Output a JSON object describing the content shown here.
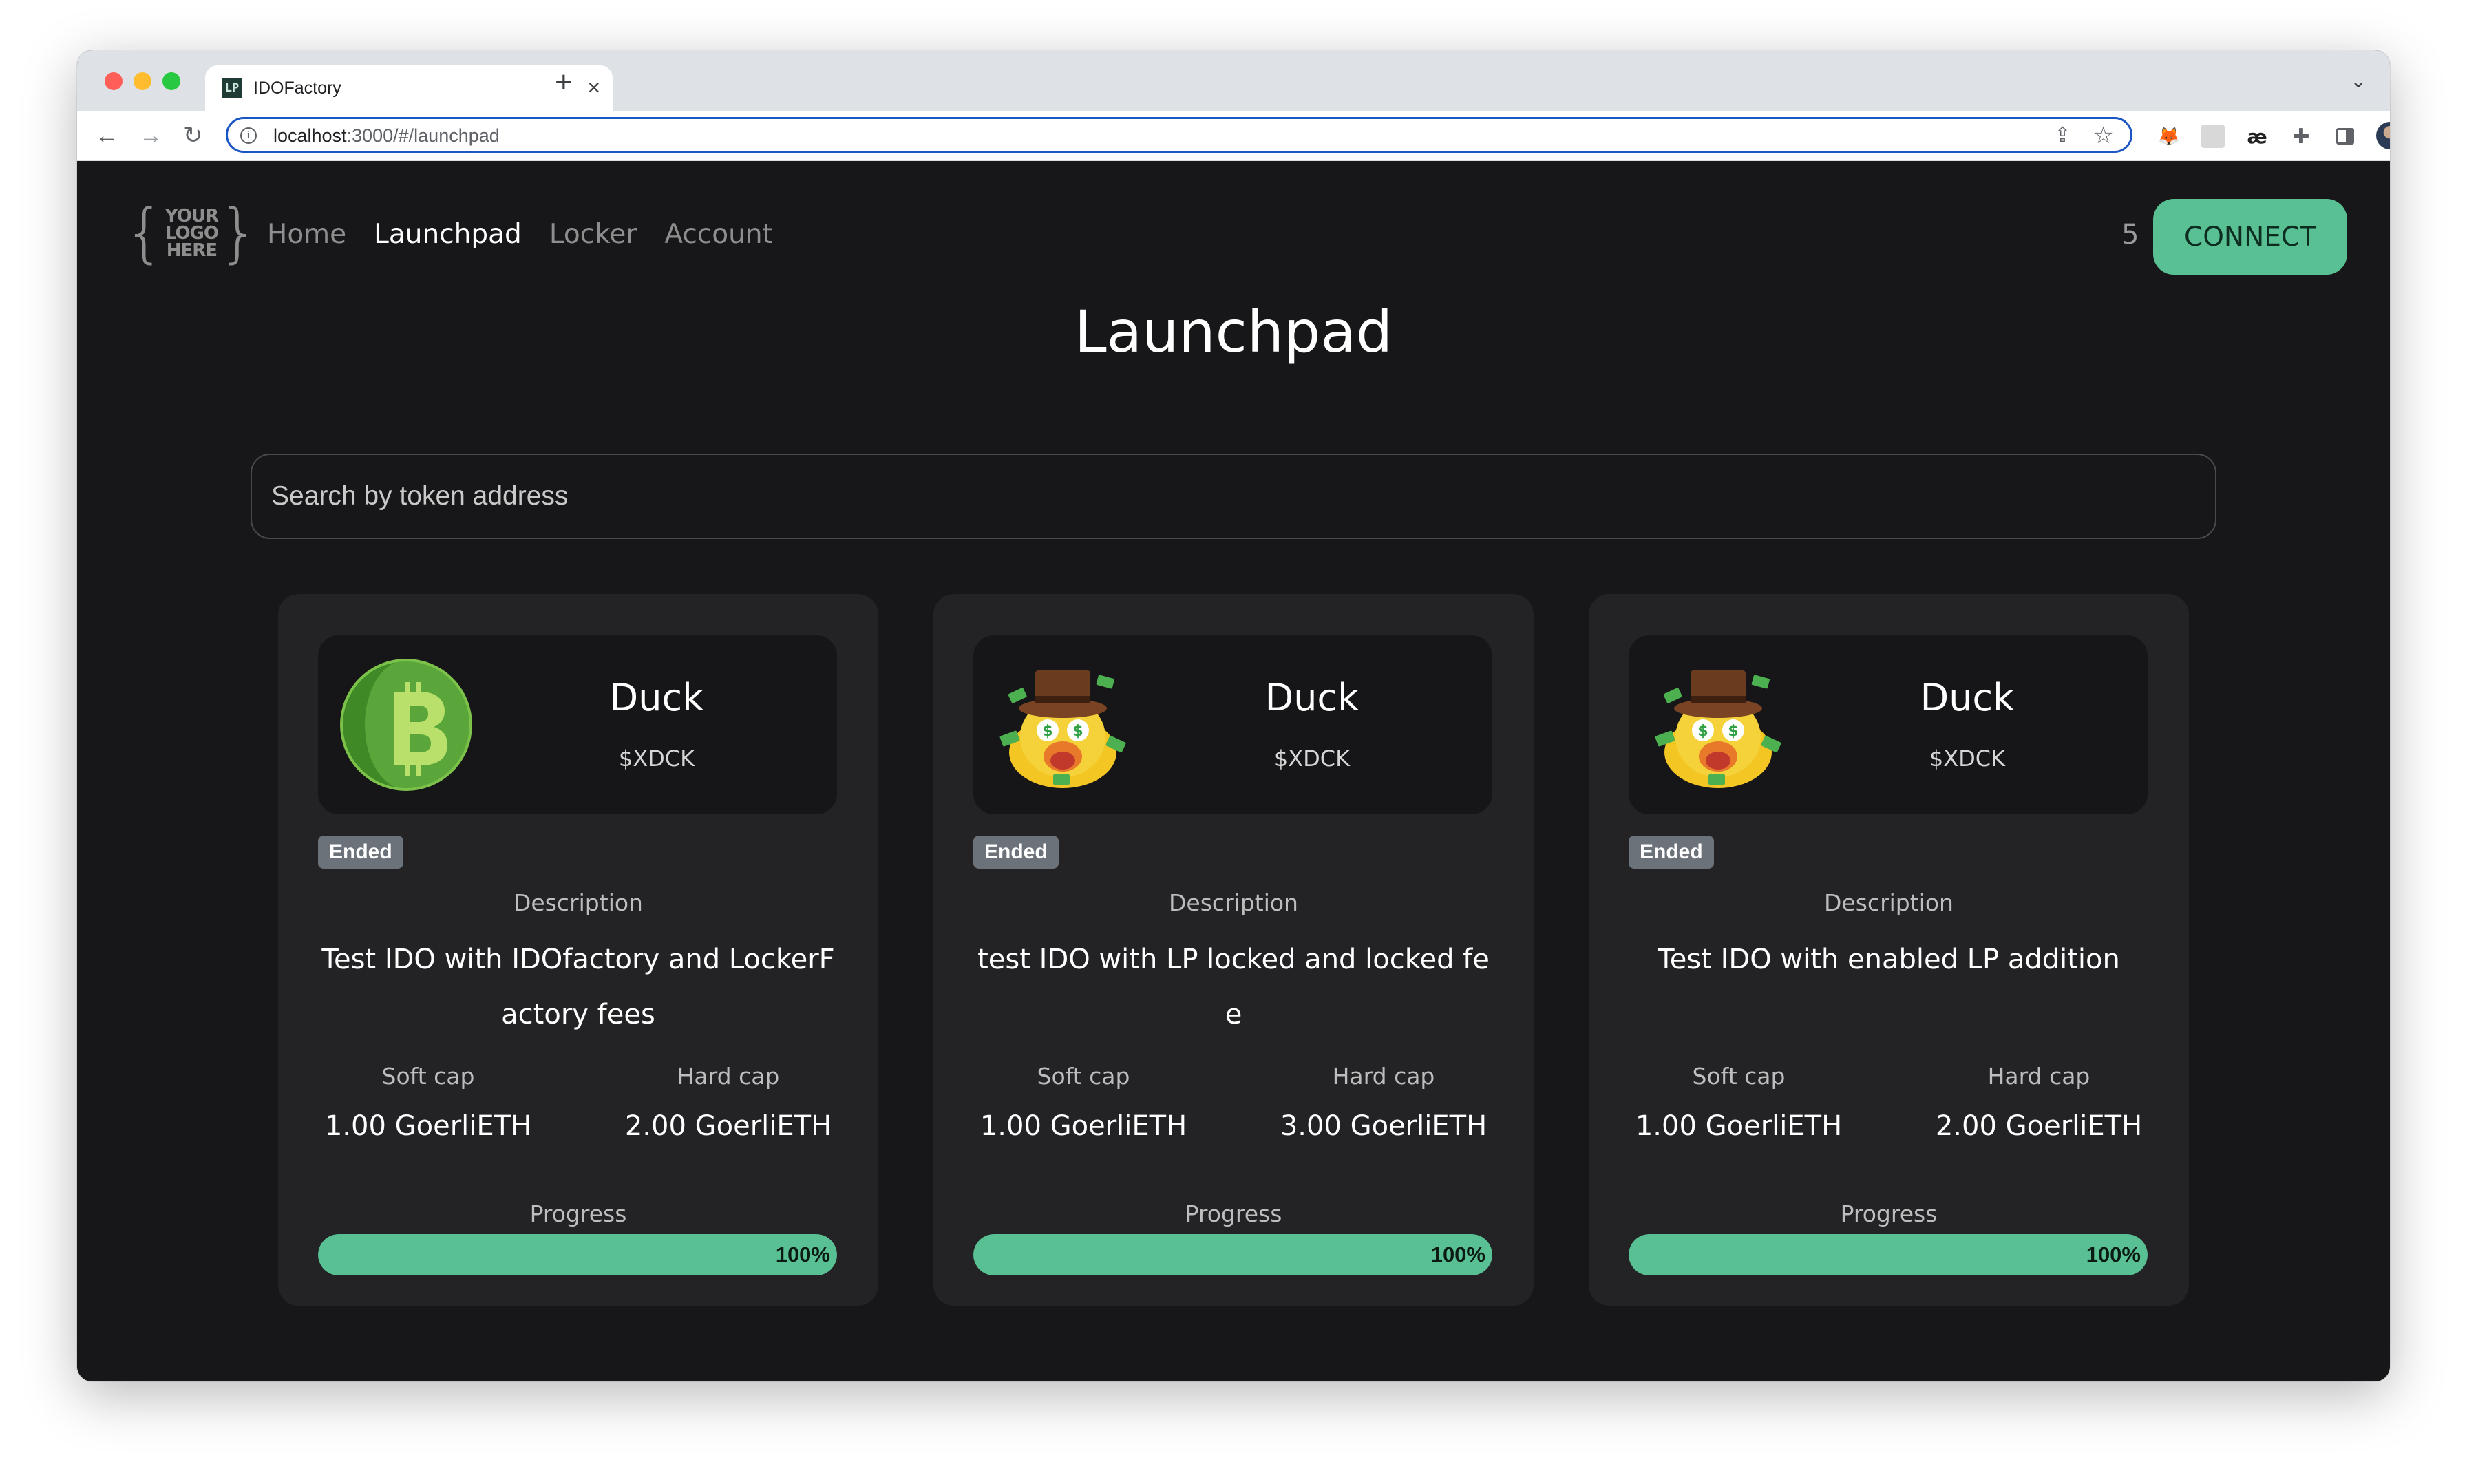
{
  "browser": {
    "tab_title": "IDOFactory",
    "tab_favicon": "LP",
    "url_host": "localhost",
    "url_path": ":3000/#/launchpad"
  },
  "header": {
    "logo": {
      "top": "YOUR",
      "mid": "LOGO",
      "bottom": "HERE"
    },
    "nav": [
      {
        "label": "Home",
        "active": false
      },
      {
        "label": "Launchpad",
        "active": true
      },
      {
        "label": "Locker",
        "active": false
      },
      {
        "label": "Account",
        "active": false
      }
    ],
    "network_count": "5",
    "connect_label": "CONNECT"
  },
  "main": {
    "title": "Launchpad",
    "search_placeholder": "Search by token address"
  },
  "cards": [
    {
      "token_name": "Duck",
      "token_symbol": "$XDCK",
      "token_icon": "green-bitcoin-coin-icon",
      "status": "Ended",
      "description_label": "Description",
      "description": "Test IDO with IDOfactory and LockerFactory fees",
      "soft_cap_label": "Soft cap",
      "soft_cap": "1.00 GoerliETH",
      "hard_cap_label": "Hard cap",
      "hard_cap": "2.00 GoerliETH",
      "progress_label": "Progress",
      "progress_text": "100%",
      "progress_percent": 100
    },
    {
      "token_name": "Duck",
      "token_symbol": "$XDCK",
      "token_icon": "duck-money-icon",
      "status": "Ended",
      "description_label": "Description",
      "description": "test IDO with LP locked and locked fee",
      "soft_cap_label": "Soft cap",
      "soft_cap": "1.00 GoerliETH",
      "hard_cap_label": "Hard cap",
      "hard_cap": "3.00 GoerliETH",
      "progress_label": "Progress",
      "progress_text": "100%",
      "progress_percent": 100
    },
    {
      "token_name": "Duck",
      "token_symbol": "$XDCK",
      "token_icon": "duck-money-icon",
      "status": "Ended",
      "description_label": "Description",
      "description": "Test IDO with enabled LP addition",
      "soft_cap_label": "Soft cap",
      "soft_cap": "1.00 GoerliETH",
      "hard_cap_label": "Hard cap",
      "hard_cap": "2.00 GoerliETH",
      "progress_label": "Progress",
      "progress_text": "100%",
      "progress_percent": 100
    }
  ],
  "colors": {
    "accent": "#59c094",
    "page_bg": "#171719",
    "card_bg": "#232326",
    "badge_bg": "#6c727a"
  }
}
